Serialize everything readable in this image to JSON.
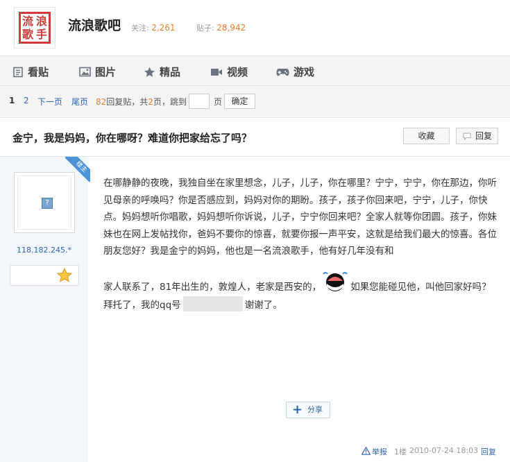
{
  "forum": {
    "logo_chars": [
      "流",
      "浪",
      "歌",
      "手"
    ],
    "name": "流浪歌吧",
    "follow_label": "关注:",
    "follow_count": "2,261",
    "posts_label": "贴子:",
    "posts_count": "28,942"
  },
  "nav": [
    {
      "label": "看贴",
      "icon": "document-icon"
    },
    {
      "label": "图片",
      "icon": "image-icon"
    },
    {
      "label": "精品",
      "icon": "star-icon"
    },
    {
      "label": "视频",
      "icon": "video-camera-icon"
    },
    {
      "label": "游戏",
      "icon": "gamepad-icon"
    }
  ],
  "pager": {
    "current_page": "1",
    "page2": "2",
    "next": "下一页",
    "last": "尾页",
    "reply_count": "82",
    "reply_label": "回复贴，共",
    "total_pages": "2",
    "pages_label": "页，跳到",
    "page_unit": "页",
    "confirm": "确定"
  },
  "thread": {
    "title": "金宁，我是妈妈，你在哪呀？难道你把家给忘了吗？",
    "collect_label": "收藏",
    "reply_label": "回复"
  },
  "author": {
    "badge": "楼主",
    "avatar_placeholder": "?",
    "ip": "118.182.245.*"
  },
  "post": {
    "text_part1": "在哪静静的夜晚，我独自坐在家里想念，儿子，儿子，你在哪里？宁宁，宁宁，你在那边，你听见母亲的呼唤吗？你是否感应到，妈妈对你的期盼。孩子，孩子你回来吧，宁宁，儿子，你快点。妈妈想听你唱歌，妈妈想听你诉说，儿子，宁宁你回来吧？全家人就等你团圆。孩子，你妹妹也在网上发帖找你，爸妈不要你的惊喜，就要你报一声平安，这就是给我们最大的惊喜。各位朋友您好？我是金宁的妈妈，他也是一名流浪歌手，他有好几年没有和",
    "text_part2": "家人联系了，81年出生的，敦煌人，老家是西安的，",
    "text_part3": "如果您能碰见他，叫他回家好吗？拜托了，我的qq号",
    "text_part4": "谢谢了。",
    "share_label": "分享",
    "report_label": "举报",
    "floor": "1楼",
    "timestamp": "2010-07-24 18:03",
    "reply_label": "回复"
  }
}
